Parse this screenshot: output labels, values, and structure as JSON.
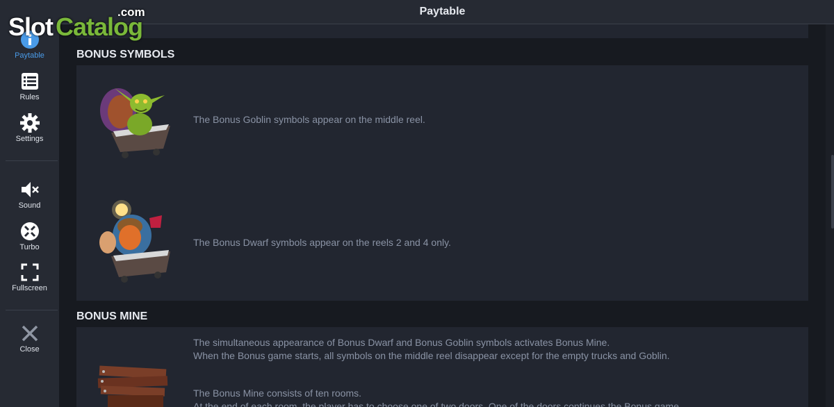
{
  "logo": {
    "slot": "Slot",
    "catalog": "Catalog",
    "com": ".com"
  },
  "header": {
    "title": "Paytable"
  },
  "nav": {
    "paytable": "Paytable",
    "rules": "Rules",
    "settings": "Settings",
    "sound": "Sound",
    "turbo": "Turbo",
    "fullscreen": "Fullscreen",
    "close": "Close"
  },
  "bonus_symbols": {
    "title": "BONUS SYMBOLS",
    "goblin_text": "The Bonus Goblin symbols appear on the middle reel.",
    "dwarf_text": "The Bonus Dwarf symbols appear on the reels 2 and 4 only."
  },
  "bonus_mine": {
    "title": "BONUS MINE",
    "line1": "The simultaneous appearance of Bonus Dwarf and Bonus Goblin symbols activates Bonus Mine.",
    "line2": "When the Bonus game starts, all symbols on the middle reel disappear except for the empty trucks and Goblin.",
    "line3": "The Bonus Mine consists of ten rooms.",
    "line4": "At the end of each room, the player has to choose one of two doors. One of the doors continues the Bonus game"
  },
  "colors": {
    "accent": "#4a9be8",
    "logo_green": "#7ab83a"
  }
}
